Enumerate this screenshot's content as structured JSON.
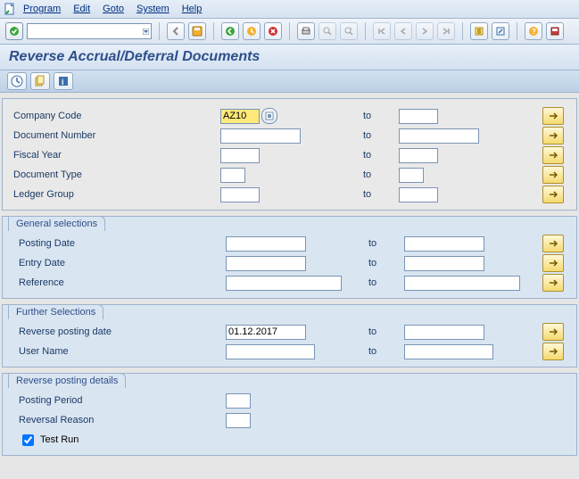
{
  "menu": {
    "program": "Program",
    "edit": "Edit",
    "goto": "Goto",
    "system": "System",
    "help": "Help"
  },
  "title": "Reverse Accrual/Deferral Documents",
  "labels": {
    "company_code": "Company Code",
    "document_number": "Document Number",
    "fiscal_year": "Fiscal Year",
    "document_type": "Document Type",
    "ledger_group": "Ledger Group",
    "to": "to",
    "general_selections": "General selections",
    "posting_date": "Posting Date",
    "entry_date": "Entry Date",
    "reference": "Reference",
    "further_selections": "Further Selections",
    "reverse_posting_date": "Reverse posting date",
    "user_name": "User Name",
    "reverse_posting_details": "Reverse posting details",
    "posting_period": "Posting Period",
    "reversal_reason": "Reversal Reason",
    "test_run": "Test Run"
  },
  "values": {
    "company_code": "AZ10",
    "document_number": "",
    "fiscal_year": "",
    "document_type": "",
    "ledger_group": "",
    "posting_date": "",
    "entry_date": "",
    "reference": "",
    "reverse_posting_date": "01.12.2017",
    "user_name": "",
    "posting_period": "",
    "reversal_reason": "",
    "test_run_checked": true
  }
}
